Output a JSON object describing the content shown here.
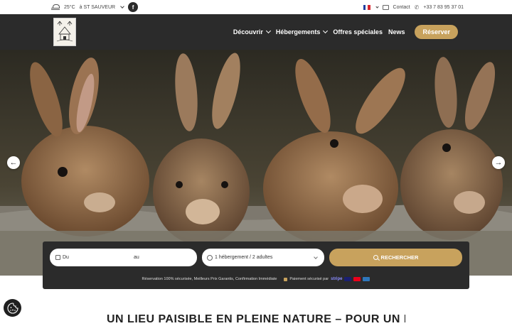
{
  "topbar": {
    "weather": "25°C",
    "location": "à ST SAUVEUR",
    "facebook": "f",
    "contact": "Contact",
    "phone": "+33 7 83 95 37 01"
  },
  "nav": {
    "items": [
      {
        "label": "Découvrir"
      },
      {
        "label": "Hébergements"
      },
      {
        "label": "Offres spéciales"
      },
      {
        "label": "News"
      }
    ],
    "reserve": "Réserver"
  },
  "booking": {
    "from": "Du",
    "to": "au",
    "guests": "1 hébergement / 2 adultes",
    "search": "RECHERCHER",
    "note": "Réservation 100% sécurisée, Meilleurs Prix Garantis, Confirmation Immédiate",
    "payment": "Paiement sécurisé par",
    "stripe": "stripe"
  },
  "colors": {
    "accent": "#c8a25d",
    "dark": "#2b2b2b"
  },
  "heading": "UN LIEU PAISIBLE EN PLEINE NATURE – POUR UN PUR BIEN"
}
